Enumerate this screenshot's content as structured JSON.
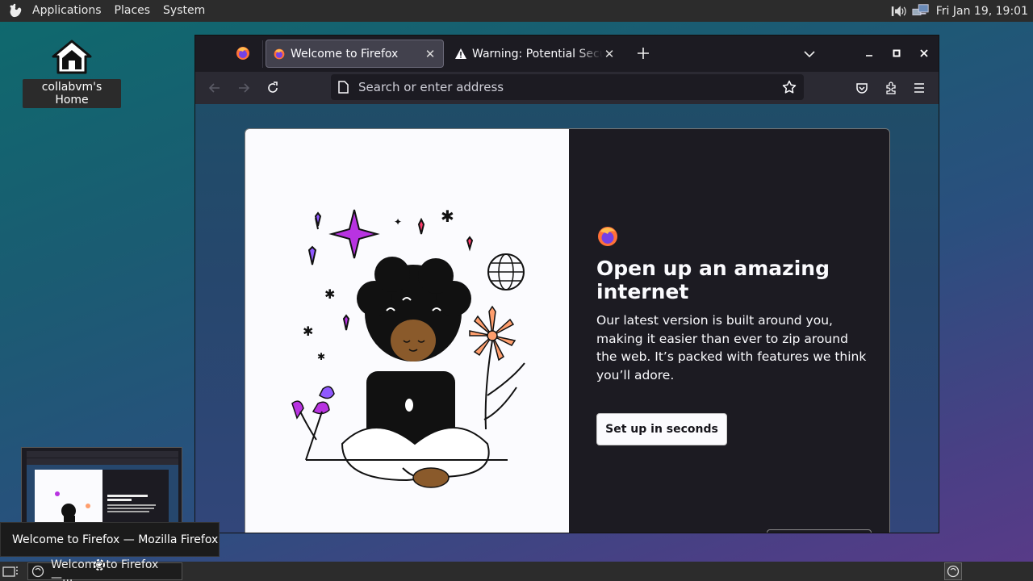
{
  "top_panel": {
    "menus": [
      "Applications",
      "Places",
      "System"
    ],
    "clock": "Fri Jan 19, 19:01",
    "icons": [
      "gnome-foot-icon",
      "speaker-icon",
      "network-icon"
    ]
  },
  "desktop": {
    "home_icon_label": "collabvm's Home"
  },
  "firefox": {
    "tabs": [
      {
        "title": "Welcome to Firefox",
        "icon": "firefox-icon",
        "active": true
      },
      {
        "title": "Warning: Potential Security Risk Ahead",
        "icon": "warning-icon",
        "active": false
      }
    ],
    "urlbar_placeholder": "Search or enter address",
    "welcome": {
      "title": "Open up an amazing internet",
      "body": "Our latest version is built around you, making it easier than ever to zip around the web. It’s packed with features we think you’ll adore.",
      "primary_button": "Set up in seconds"
    }
  },
  "tooltip": {
    "text": "Welcome to Firefox — Mozilla Firefox"
  },
  "taskbar": {
    "task_label": "Welcome to Firefox —..."
  },
  "colors": {
    "panel": "#2c2c2c",
    "firefox_chrome": "#1c1b22",
    "accent_purple": "#b833e1",
    "accent_orange": "#ff9e6d"
  }
}
